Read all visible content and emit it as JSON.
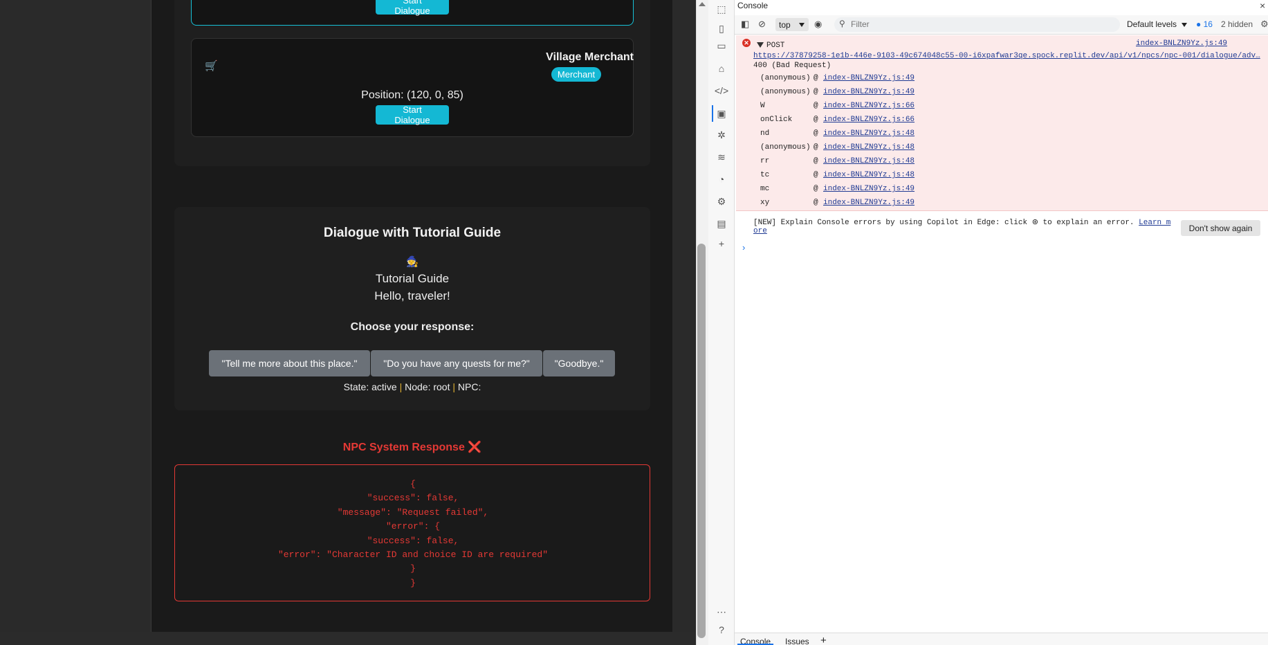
{
  "page": {
    "top_button_label": "Start Dialogue",
    "merchant": {
      "icon": "cart-icon",
      "name": "Village Merchant",
      "badge": "Merchant",
      "position": "Position: (120, 0, 85)",
      "button_label": "Start Dialogue"
    },
    "dialogue": {
      "title": "Dialogue with Tutorial Guide",
      "avatar": "🧙",
      "npc_name": "Tutorial Guide",
      "text": "Hello, traveler!",
      "choose_label": "Choose your response:",
      "responses": [
        "\"Tell me more about this place.\"",
        "\"Do you have any quests for me?\"",
        "\"Goodbye.\""
      ],
      "state_label": "State: active",
      "separator": "|",
      "node_label": "Node: root",
      "npc_label": "NPC:"
    },
    "system_response": {
      "title": "NPC System Response ❌",
      "json_text": "{\n\"success\": false,\n\"message\": \"Request failed\",\n\"error\": {\n\"success\": false,\n\"error\": \"Character ID and choice ID are required\"\n}\n}"
    }
  },
  "devtools": {
    "panel_title": "Console",
    "context": "top",
    "filter_placeholder": "Filter",
    "levels": "Default levels",
    "issue_count": "16",
    "hidden_count": "2 hidden",
    "error": {
      "method": "POST",
      "source": "index-BNLZN9Yz.js:49",
      "url": "https://37879258-1e1b-446e-9103-49c674048c55-00-i6xpafwar3qe.spock.replit.dev/api/v1/npcs/npc-001/dialogue/adv…",
      "status": "400 (Bad Request)",
      "frames": [
        {
          "name": "(anonymous)",
          "at": "@",
          "link": "index-BNLZN9Yz.js:49"
        },
        {
          "name": "(anonymous)",
          "at": "@",
          "link": "index-BNLZN9Yz.js:49"
        },
        {
          "name": "W",
          "at": "@",
          "link": "index-BNLZN9Yz.js:66"
        },
        {
          "name": "onClick",
          "at": "@",
          "link": "index-BNLZN9Yz.js:66"
        },
        {
          "name": "nd",
          "at": "@",
          "link": "index-BNLZN9Yz.js:48"
        },
        {
          "name": "(anonymous)",
          "at": "@",
          "link": "index-BNLZN9Yz.js:48"
        },
        {
          "name": "rr",
          "at": "@",
          "link": "index-BNLZN9Yz.js:48"
        },
        {
          "name": "tc",
          "at": "@",
          "link": "index-BNLZN9Yz.js:48"
        },
        {
          "name": "mc",
          "at": "@",
          "link": "index-BNLZN9Yz.js:49"
        },
        {
          "name": "xy",
          "at": "@",
          "link": "index-BNLZN9Yz.js:49"
        }
      ]
    },
    "copilot": {
      "text_before": "[NEW] Explain Console errors by using Copilot in Edge: click",
      "text_after": "to explain an error.",
      "link_line1": "Learn m",
      "link_line2": "ore",
      "dont_show": "Don't show again"
    },
    "prompt": "›",
    "drawer_tabs": [
      "Console",
      "Issues"
    ],
    "drawer_add": "+"
  }
}
